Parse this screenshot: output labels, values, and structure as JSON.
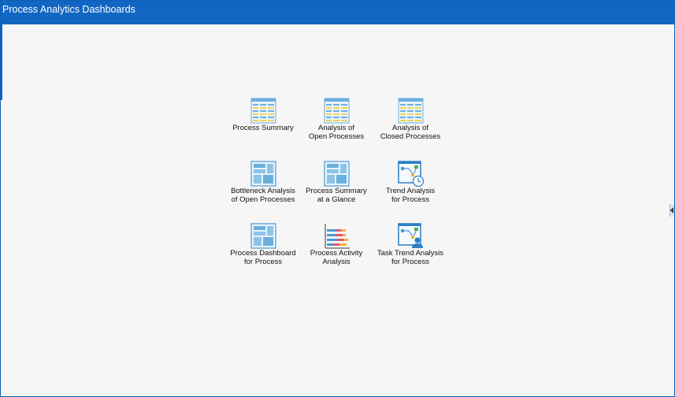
{
  "window": {
    "title": "Process Analytics Dashboards"
  },
  "tiles": [
    {
      "id": "process-summary",
      "icon": "table-report-icon",
      "label": "Process Summary"
    },
    {
      "id": "analysis-of-open-processes",
      "icon": "table-report-icon",
      "label": "Analysis of\nOpen Processes"
    },
    {
      "id": "analysis-of-closed-processes",
      "icon": "table-report-icon",
      "label": "Analysis of\nClosed Processes"
    },
    {
      "id": "bottleneck-analysis-of-open-processes",
      "icon": "dashboard-layout-icon",
      "label": "Bottleneck Analysis\nof Open Processes"
    },
    {
      "id": "process-summary-at-a-glance",
      "icon": "dashboard-layout-icon",
      "label": "Process Summary\nat a Glance"
    },
    {
      "id": "trend-analysis-for-process",
      "icon": "trend-clock-icon",
      "label": "Trend Analysis\nfor Process"
    },
    {
      "id": "process-dashboard-for-process",
      "icon": "dashboard-layout-icon",
      "label": "Process Dashboard\nfor Process"
    },
    {
      "id": "process-activity-analysis",
      "icon": "bar-chart-icon",
      "label": "Process Activity\nAnalysis"
    },
    {
      "id": "task-trend-analysis-for-process",
      "icon": "trend-user-icon",
      "label": "Task Trend Analysis\nfor Process"
    }
  ],
  "colors": {
    "titlebar": "#1266c3",
    "background": "#f6f6f6",
    "icon_blue": "#6ab0de",
    "icon_yellow": "#f3d24e"
  }
}
